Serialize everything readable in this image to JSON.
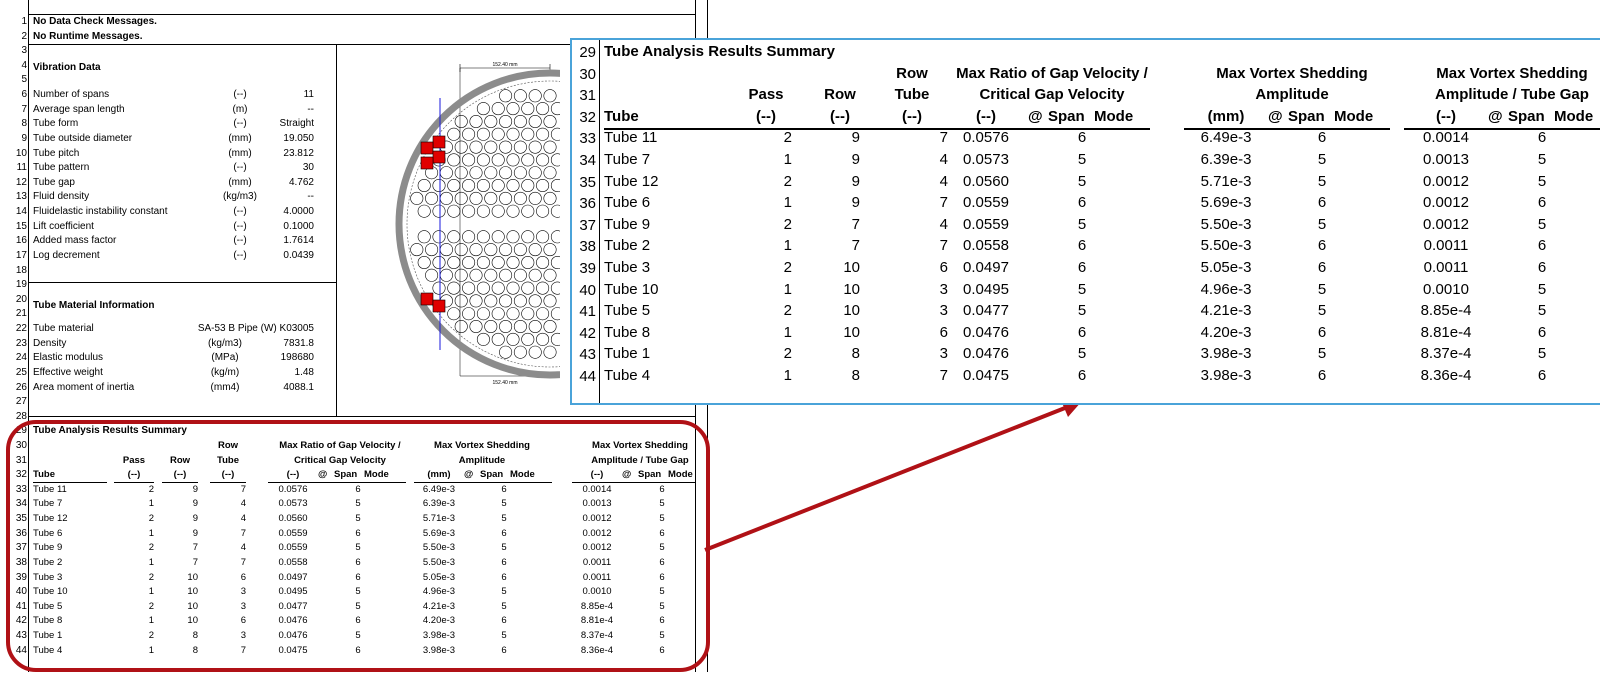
{
  "messages": {
    "no_data_check": "No Data Check Messages.",
    "no_runtime": "No Runtime Messages."
  },
  "vibration": {
    "title": "Vibration Data",
    "rows": [
      {
        "label": "Number of spans",
        "unit": "(--)",
        "value": "11"
      },
      {
        "label": "Average span length",
        "unit": "(m)",
        "value": "--"
      },
      {
        "label": "Tube form",
        "unit": "(--)",
        "value": "Straight"
      },
      {
        "label": "Tube outside diameter",
        "unit": "(mm)",
        "value": "19.050"
      },
      {
        "label": "Tube pitch",
        "unit": "(mm)",
        "value": "23.812"
      },
      {
        "label": "Tube pattern",
        "unit": "(--)",
        "value": "30"
      },
      {
        "label": "Tube gap",
        "unit": "(mm)",
        "value": "4.762"
      },
      {
        "label": "Fluid density",
        "unit": "(kg/m3)",
        "value": "--"
      },
      {
        "label": "Fluidelastic instability constant",
        "unit": "(--)",
        "value": "4.0000"
      },
      {
        "label": "Lift coefficient",
        "unit": "(--)",
        "value": "0.1000"
      },
      {
        "label": "Added mass factor",
        "unit": "(--)",
        "value": "1.7614"
      },
      {
        "label": "Log decrement",
        "unit": "(--)",
        "value": "0.0439"
      }
    ]
  },
  "material": {
    "title": "Tube Material Information",
    "rows": [
      {
        "label": "Tube material",
        "unit": "",
        "value": "SA-53 B Pipe (W) K03005"
      },
      {
        "label": "Density",
        "unit": "(kg/m3)",
        "value": "7831.8"
      },
      {
        "label": "Elastic modulus",
        "unit": "(MPa)",
        "value": "198680"
      },
      {
        "label": "Effective weight",
        "unit": "(kg/m)",
        "value": "1.48"
      },
      {
        "label": "Area moment of inertia",
        "unit": "(mm4)",
        "value": "4088.1"
      }
    ]
  },
  "row_numbers": [
    "1",
    "2",
    "3",
    "4",
    "5",
    "6",
    "7",
    "8",
    "9",
    "10",
    "11",
    "12",
    "13",
    "14",
    "15",
    "16",
    "17",
    "18",
    "19",
    "20",
    "21",
    "22",
    "23",
    "24",
    "25",
    "26",
    "27",
    "28",
    "29",
    "30",
    "31",
    "32",
    "33",
    "34",
    "35",
    "36",
    "37",
    "38",
    "39",
    "40",
    "41",
    "42",
    "43",
    "44"
  ],
  "layout_dims": {
    "top": "152.40 mm",
    "bottom": "152.40 mm"
  },
  "summary": {
    "title": "Tube Analysis Results Summary",
    "headers": {
      "tube": "Tube",
      "pass": "Pass",
      "pass_unit": "(--)",
      "row": "Row",
      "row_unit": "(--)",
      "rowtube_1": "Row",
      "rowtube_2": "Tube",
      "rowtube_unit": "(--)",
      "ratio_1": "Max Ratio of Gap Velocity /",
      "ratio_2": "Critical Gap Velocity",
      "ratio_unit": "(--)",
      "amp_1": "Max Vortex Shedding",
      "amp_2": "Amplitude",
      "amp_unit": "(mm)",
      "gap_1": "Max Vortex Shedding",
      "gap_2": "Amplitude / Tube Gap",
      "gap_unit": "(--)",
      "at": "@",
      "span": "Span",
      "mode": "Mode"
    },
    "rows": [
      {
        "tube": "Tube 11",
        "pass": "2",
        "row": "9",
        "rowtube": "7",
        "ratio": "0.0576",
        "ratio_span": "6",
        "amp": "6.49e-3",
        "amp_span": "6",
        "gap": "0.0014",
        "gap_span": "6"
      },
      {
        "tube": "Tube 7",
        "pass": "1",
        "row": "9",
        "rowtube": "4",
        "ratio": "0.0573",
        "ratio_span": "5",
        "amp": "6.39e-3",
        "amp_span": "5",
        "gap": "0.0013",
        "gap_span": "5"
      },
      {
        "tube": "Tube 12",
        "pass": "2",
        "row": "9",
        "rowtube": "4",
        "ratio": "0.0560",
        "ratio_span": "5",
        "amp": "5.71e-3",
        "amp_span": "5",
        "gap": "0.0012",
        "gap_span": "5"
      },
      {
        "tube": "Tube 6",
        "pass": "1",
        "row": "9",
        "rowtube": "7",
        "ratio": "0.0559",
        "ratio_span": "6",
        "amp": "5.69e-3",
        "amp_span": "6",
        "gap": "0.0012",
        "gap_span": "6"
      },
      {
        "tube": "Tube 9",
        "pass": "2",
        "row": "7",
        "rowtube": "4",
        "ratio": "0.0559",
        "ratio_span": "5",
        "amp": "5.50e-3",
        "amp_span": "5",
        "gap": "0.0012",
        "gap_span": "5"
      },
      {
        "tube": "Tube 2",
        "pass": "1",
        "row": "7",
        "rowtube": "7",
        "ratio": "0.0558",
        "ratio_span": "6",
        "amp": "5.50e-3",
        "amp_span": "6",
        "gap": "0.0011",
        "gap_span": "6"
      },
      {
        "tube": "Tube 3",
        "pass": "2",
        "row": "10",
        "rowtube": "6",
        "ratio": "0.0497",
        "ratio_span": "6",
        "amp": "5.05e-3",
        "amp_span": "6",
        "gap": "0.0011",
        "gap_span": "6"
      },
      {
        "tube": "Tube 10",
        "pass": "1",
        "row": "10",
        "rowtube": "3",
        "ratio": "0.0495",
        "ratio_span": "5",
        "amp": "4.96e-3",
        "amp_span": "5",
        "gap": "0.0010",
        "gap_span": "5"
      },
      {
        "tube": "Tube 5",
        "pass": "2",
        "row": "10",
        "rowtube": "3",
        "ratio": "0.0477",
        "ratio_span": "5",
        "amp": "4.21e-3",
        "amp_span": "5",
        "gap": "8.85e-4",
        "gap_span": "5"
      },
      {
        "tube": "Tube 8",
        "pass": "1",
        "row": "10",
        "rowtube": "6",
        "ratio": "0.0476",
        "ratio_span": "6",
        "amp": "4.20e-3",
        "amp_span": "6",
        "gap": "8.81e-4",
        "gap_span": "6"
      },
      {
        "tube": "Tube 1",
        "pass": "2",
        "row": "8",
        "rowtube": "3",
        "ratio": "0.0476",
        "ratio_span": "5",
        "amp": "3.98e-3",
        "amp_span": "5",
        "gap": "8.37e-4",
        "gap_span": "5"
      },
      {
        "tube": "Tube 4",
        "pass": "1",
        "row": "8",
        "rowtube": "7",
        "ratio": "0.0475",
        "ratio_span": "6",
        "amp": "3.98e-3",
        "amp_span": "6",
        "gap": "8.36e-4",
        "gap_span": "6"
      }
    ]
  },
  "colors": {
    "highlight": "#b01116",
    "zoom_border": "#4aa3d9",
    "tube_marker": "#e00000",
    "baffle_line": "#1a1adc",
    "shell": "#8c8c8c"
  }
}
